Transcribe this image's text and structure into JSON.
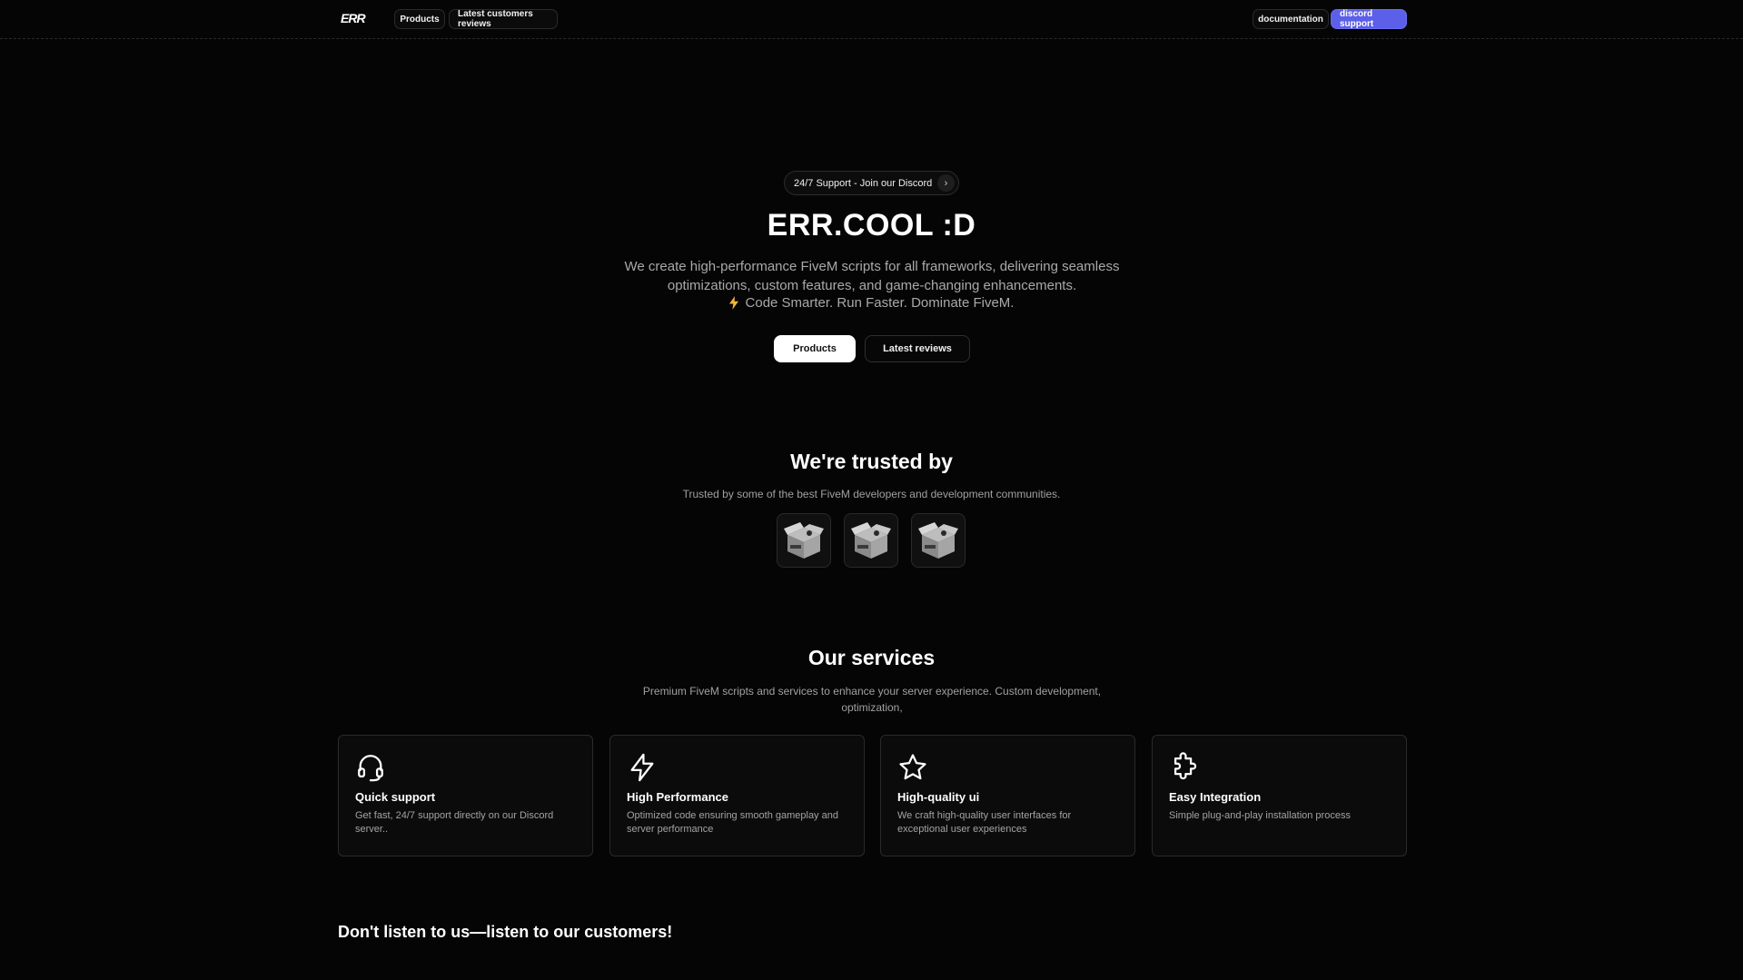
{
  "nav": {
    "products_label": "Products",
    "reviews_label": "Latest customers reviews",
    "docs_label": "documentation",
    "discord_label": "discord support",
    "accent_color": "#5b5fe9"
  },
  "hero": {
    "support_pill": "24/7 Support - Join our Discord",
    "title": "ERR.COOL :D",
    "description": "We create high-performance FiveM scripts for all frameworks, delivering seamless optimizations, custom features, and game-changing enhancements.",
    "tagline": "Code Smarter. Run Faster. Dominate FiveM.",
    "btn_products": "Products",
    "btn_reviews": "Latest reviews"
  },
  "trusted": {
    "title": "We're trusted by",
    "subtitle": "Trusted by some of the best FiveM developers and development communities.",
    "partners": [
      "box-icon",
      "box-icon",
      "box-icon"
    ]
  },
  "services": {
    "title": "Our services",
    "subtitle": "Premium FiveM scripts and services to enhance your server experience. Custom development, optimization,",
    "cards": [
      {
        "icon": "headset-icon",
        "title": "Quick support",
        "text": "Get fast, 24/7 support directly on our Discord server.."
      },
      {
        "icon": "lightning-icon",
        "title": "High Performance",
        "text": "Optimized code ensuring smooth gameplay and server performance"
      },
      {
        "icon": "star-icon",
        "title": "High-quality ui",
        "text": "We craft high-quality user interfaces for exceptional user experiences"
      },
      {
        "icon": "puzzle-icon",
        "title": "Easy Integration",
        "text": "Simple plug-and-play installation process"
      }
    ]
  },
  "customers": {
    "title": "Don't listen to us—listen to our customers!"
  }
}
